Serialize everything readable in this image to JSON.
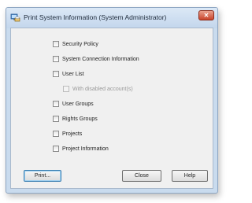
{
  "window": {
    "title": "Print System Information (System Administrator)",
    "close_glyph": "✕"
  },
  "options": [
    {
      "label": "Security Policy",
      "checked": false,
      "enabled": true
    },
    {
      "label": "System Connection Information",
      "checked": false,
      "enabled": true
    },
    {
      "label": "User List",
      "checked": false,
      "enabled": true
    },
    {
      "label": "With disabled account(s)",
      "checked": false,
      "enabled": false
    },
    {
      "label": "User Groups",
      "checked": false,
      "enabled": true
    },
    {
      "label": "Rights Groups",
      "checked": false,
      "enabled": true
    },
    {
      "label": "Projects",
      "checked": false,
      "enabled": true
    },
    {
      "label": "Project Information",
      "checked": false,
      "enabled": true
    }
  ],
  "buttons": {
    "print": "Print...",
    "close": "Close",
    "help": "Help"
  },
  "icons": {
    "title_icon": "printer-computer-icon",
    "close_icon": "close-icon"
  },
  "colors": {
    "titlebar": "#c9dbee",
    "close_button": "#c8432a",
    "client_background": "#f0f0f0"
  }
}
